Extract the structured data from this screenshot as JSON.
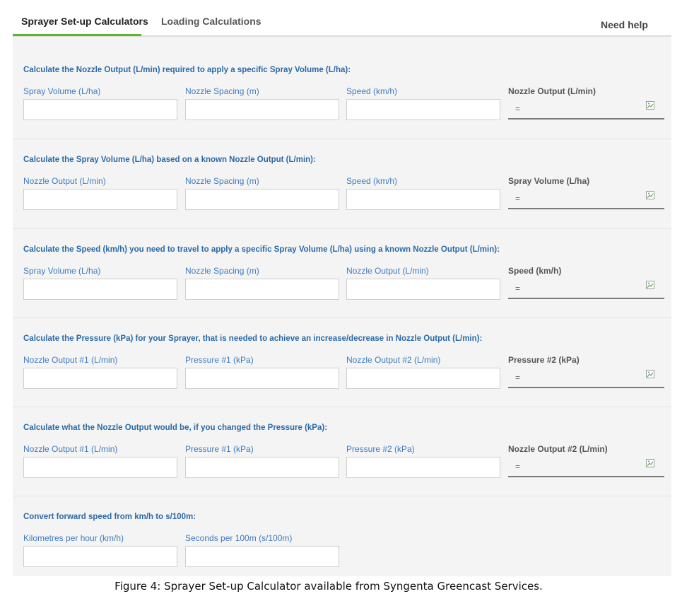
{
  "tabs": {
    "tab1": "Sprayer Set-up Calculators",
    "tab2": "Loading Calculations",
    "help": "Need help"
  },
  "sections": [
    {
      "title": "Calculate the Nozzle Output (L/min) required to apply a specific Spray Volume (L/ha):",
      "fields": [
        "Spray Volume (L/ha)",
        "Nozzle Spacing (m)",
        "Speed (km/h)"
      ],
      "result_label": "Nozzle Output (L/min)",
      "result_value": "="
    },
    {
      "title": "Calculate the Spray Volume (L/ha) based on a known Nozzle Output (L/min):",
      "fields": [
        "Nozzle Output (L/min)",
        "Nozzle Spacing (m)",
        "Speed (km/h)"
      ],
      "result_label": "Spray Volume (L/ha)",
      "result_value": "="
    },
    {
      "title": "Calculate the Speed (km/h) you need to travel to apply a specific Spray Volume (L/ha) using a known Nozzle Output (L/min):",
      "fields": [
        "Spray Volume (L/ha)",
        "Nozzle Spacing (m)",
        "Nozzle Output (L/min)"
      ],
      "result_label": "Speed (km/h)",
      "result_value": "="
    },
    {
      "title": "Calculate the Pressure (kPa) for your Sprayer, that is needed to achieve an increase/decrease in Nozzle Output (L/min):",
      "fields": [
        "Nozzle Output #1 (L/min)",
        "Pressure #1 (kPa)",
        "Nozzle Output #2 (L/min)"
      ],
      "result_label": "Pressure #2 (kPa)",
      "result_value": "="
    },
    {
      "title": "Calculate what the Nozzle Output would be, if you changed the Pressure (kPa):",
      "fields": [
        "Nozzle Output #1 (L/min)",
        "Pressure #1 (kPa)",
        "Pressure #2 (kPa)"
      ],
      "result_label": "Nozzle Output #2 (L/min)",
      "result_value": "="
    },
    {
      "title": "Convert forward speed from km/h to s/100m:",
      "fields": [
        "Kilometres per hour (km/h)",
        "Seconds per 100m (s/100m)"
      ]
    }
  ],
  "caption": "Figure 4: Sprayer Set-up Calculator available from Syngenta Greencast Services.",
  "colors": {
    "accent": "#5cb531",
    "label_blue": "#3f7bbf",
    "title_blue": "#2a6aa8"
  }
}
